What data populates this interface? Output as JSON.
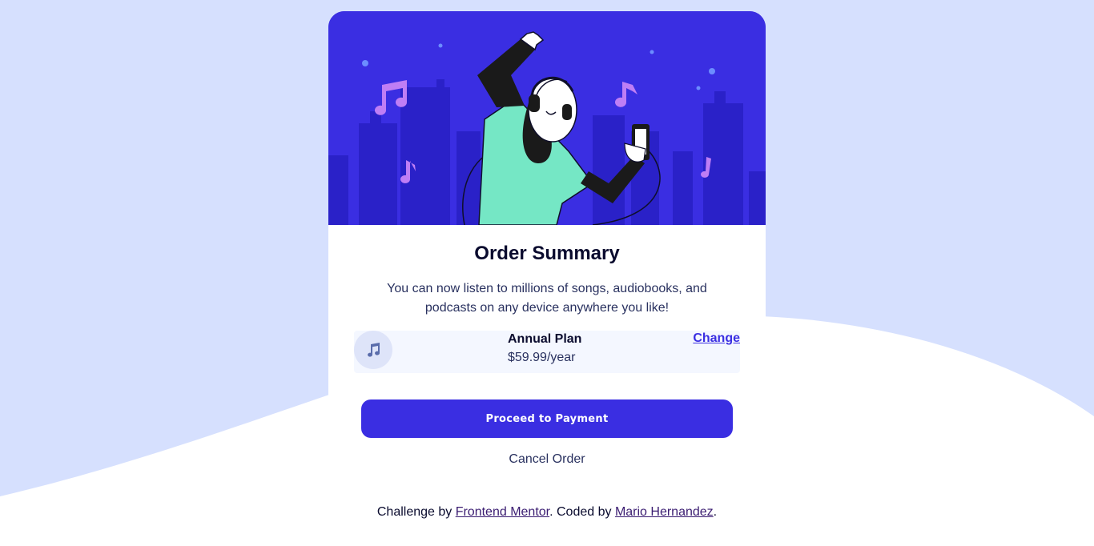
{
  "card": {
    "title": "Order Summary",
    "description": "You can now listen to millions of songs, audiobooks, and podcasts on any device anywhere you like!",
    "plan": {
      "icon": "music-note-icon",
      "name": "Annual Plan",
      "price": "$59.99/year",
      "change_label": "Change"
    },
    "pay_label": "Proceed to Payment",
    "cancel_label": "Cancel Order"
  },
  "attribution": {
    "prefix": "Challenge by ",
    "link1": "Frontend Mentor",
    "middle": ". Coded by ",
    "link2": "Mario Hernandez",
    "suffix": "."
  },
  "colors": {
    "background": "#d6e0fe",
    "accent": "#3a2ee2",
    "hero_bg": "#3a2ee2",
    "plan_bg": "#f4f7ff",
    "text_dark": "#0a0b2e",
    "text_muted": "#29315f"
  }
}
